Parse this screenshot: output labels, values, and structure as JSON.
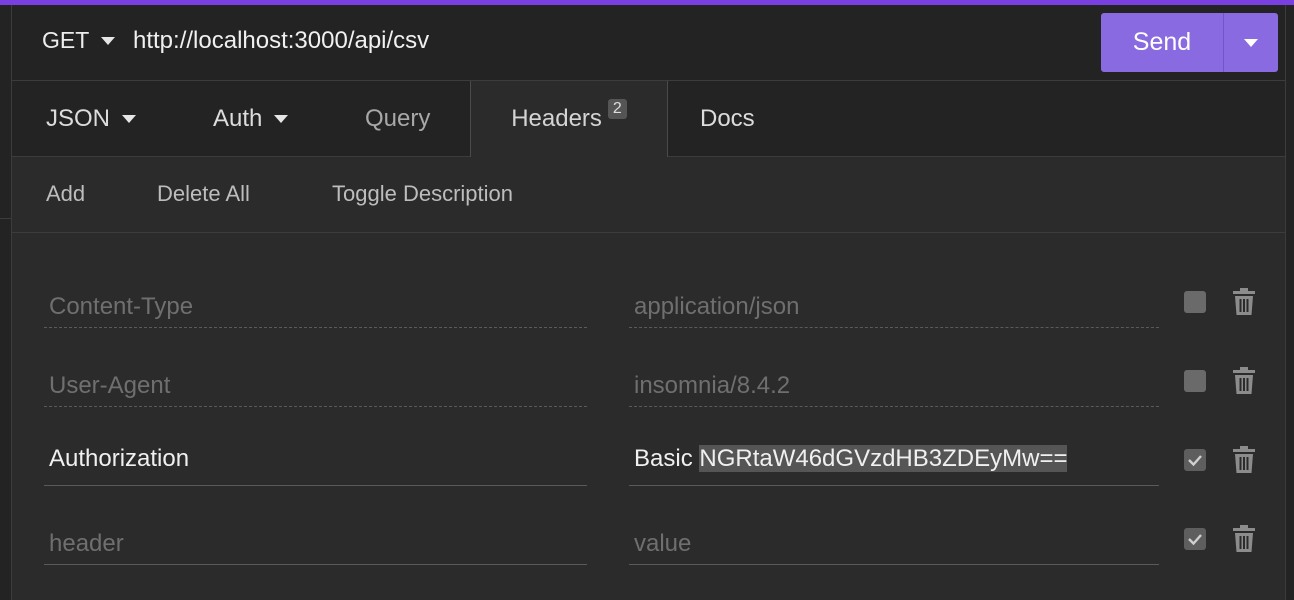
{
  "request": {
    "method": "GET",
    "url": "http://localhost:3000/api/csv",
    "send_label": "Send"
  },
  "tabs": [
    {
      "label": "JSON"
    },
    {
      "label": "Auth"
    },
    {
      "label": "Query"
    },
    {
      "label": "Headers",
      "badge": "2"
    },
    {
      "label": "Docs"
    }
  ],
  "toolbar": {
    "add": "Add",
    "delete_all": "Delete All",
    "toggle_description": "Toggle Description"
  },
  "headers": [
    {
      "name_placeholder": "Content-Type",
      "value_placeholder": "application/json",
      "name": "",
      "value": "",
      "enabled": false
    },
    {
      "name_placeholder": "User-Agent",
      "value_placeholder": "insomnia/8.4.2",
      "name": "",
      "value": "",
      "enabled": false
    },
    {
      "name": "Authorization",
      "value_prefix": "Basic ",
      "value_selected": "NGRtaW46dGVzdHB3ZDEyMw==",
      "enabled": true
    },
    {
      "name_placeholder": "header",
      "value_placeholder": "value",
      "name": "",
      "value": "",
      "enabled": true
    }
  ],
  "colors": {
    "accent": "#7a3fe0",
    "send": "#8a6ae0",
    "background": "#2b2b2b"
  }
}
